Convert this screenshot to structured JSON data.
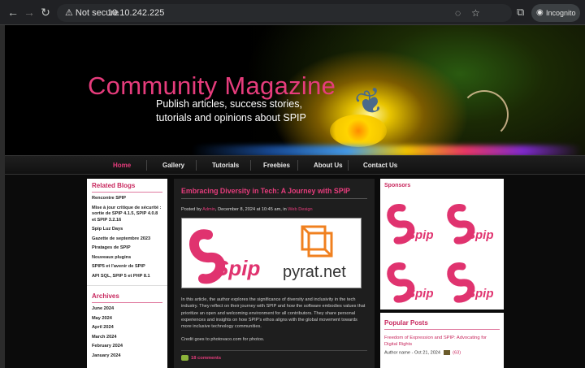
{
  "browser": {
    "security_label": "Not secure",
    "url": "10.10.242.225",
    "incognito_label": "Incognito"
  },
  "site": {
    "title": "Community Magazine",
    "tagline": "Publish articles, success stories, tutorials and opinions about SPIP",
    "nav": [
      "Home",
      "Gallery",
      "Tutorials",
      "Freebies",
      "About Us",
      "Contact Us"
    ],
    "accent": "#e63c7c"
  },
  "sidebar": {
    "related_heading": "Related Blogs",
    "related": [
      "Rencontre SPIP",
      "Mise à jour critique de sécurité : sortie de SPIP 4.1.5, SPIP 4.0.8 et SPIP 3.2.16",
      "Spip Luz Days",
      "Gazette de septembre 2023",
      "Piratages de SPIP",
      "Nouveaux plugins",
      "SPIP5 et l'avenir de SPIP",
      "API SQL, SPIP 5 et PHP 8.1"
    ],
    "archives_heading": "Archives",
    "archives": [
      "June 2024",
      "May 2024",
      "April 2024",
      "March 2024",
      "February 2024",
      "January 2024"
    ]
  },
  "post": {
    "title": "Embracing Diversity in Tech: A Journey with SPIP",
    "meta_prefix": "Posted by",
    "author": "Admin",
    "meta_mid": ", December 8, 2024 at 10:45 am, in",
    "category": "Web Design",
    "image_text_left": "Spip",
    "image_text_right": "pyrat.net",
    "excerpt": "In this article, the author explores the significance of diversity and inclusivity in the tech industry. They reflect on their journey with SPIP and how the software embodies values that prioritize an open and welcoming environment for all contributors. They share personal experiences and insights on how SPIP's ethos aligns with the global movement towards more inclusive technology communities.",
    "credit": "Credit goes to photovaco.com for photos.",
    "comments": "18 comments"
  },
  "right": {
    "sponsors_heading": "Sponsors",
    "sponsor_logo_text": "Spip",
    "popular_heading": "Popular Posts",
    "popular_link": "Freedom of Expression and SPIP: Advocating for Digital Rights",
    "popular_meta": "Author name - Oct 21, 2024",
    "popular_count": "(63)"
  }
}
